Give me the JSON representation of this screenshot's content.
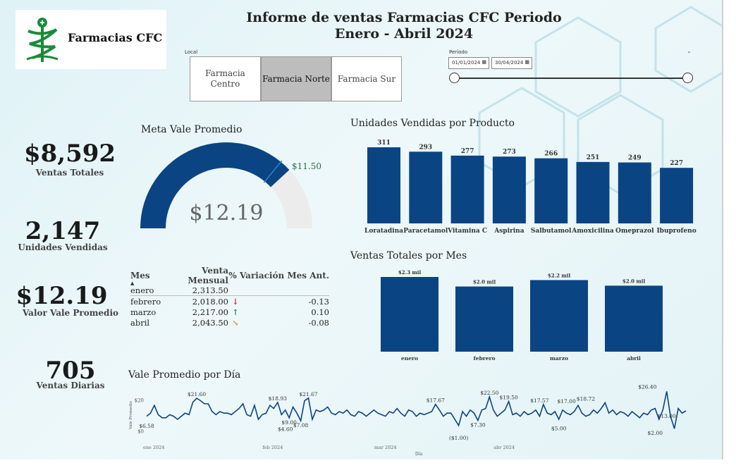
{
  "header": {
    "logo_text": "Farmacias CFC",
    "title_line1": "Informe de ventas Farmacias CFC Periodo",
    "title_line2": "Enero - Abril 2024"
  },
  "slicers": {
    "local_label": "Local",
    "options": [
      {
        "label": "Farmacia Centro",
        "selected": false
      },
      {
        "label": "Farmacia Norte",
        "selected": true
      },
      {
        "label": "Farmacia Sur",
        "selected": false
      }
    ],
    "period_label": "Período",
    "date_start": "01/01/2024",
    "date_end": "30/04/2024"
  },
  "kpis": {
    "ventas_totales": {
      "value": "$8,592",
      "label": "Ventas Totales"
    },
    "unidades_vendidas": {
      "value": "2,147",
      "label": "Unidades Vendidas"
    },
    "valor_vale": {
      "value": "$12.19",
      "label": "Valor Vale Promedio"
    },
    "ventas_diarias": {
      "value": "705",
      "label": "Ventas Diarias"
    }
  },
  "colors": {
    "primary": "#0b4483",
    "gauge_bg": "#ececec",
    "down": "#cc2e2e",
    "up": "#3a8d3a",
    "neutral": "#d29a2a"
  },
  "table": {
    "headers": [
      "Mes",
      "Venta Mensual",
      "% Variación Mes Ant."
    ],
    "rows": [
      {
        "mes": "enero",
        "venta": "2,313.50",
        "icon": "",
        "var": ""
      },
      {
        "mes": "febrero",
        "venta": "2,018.00",
        "icon": "↓",
        "var": "-0.13"
      },
      {
        "mes": "marzo",
        "venta": "2,217.00",
        "icon": "↑",
        "var": "0.10"
      },
      {
        "mes": "abril",
        "venta": "2,043.50",
        "icon": "↘",
        "var": "-0.08"
      }
    ]
  },
  "chart_data": [
    {
      "type": "gauge",
      "title": "Meta Vale Promedio",
      "value": 12.19,
      "value_label": "$12.19",
      "target": 11.5,
      "target_label": "$11.50",
      "min": 0,
      "max": 16
    },
    {
      "type": "bar",
      "title": "Unidades Vendidas por Producto",
      "categories": [
        "Loratadina",
        "Paracetamol",
        "Vitamina C",
        "Aspirina",
        "Salbutamol",
        "Amoxicilina",
        "Omeprazol",
        "Ibuprofeno"
      ],
      "values": [
        311,
        293,
        277,
        273,
        266,
        251,
        249,
        227
      ],
      "data_labels": [
        "311",
        "293",
        "277",
        "273",
        "266",
        "251",
        "249",
        "227"
      ]
    },
    {
      "type": "bar",
      "title": "Ventas Totales por Mes",
      "categories": [
        "enero",
        "febrero",
        "marzo",
        "abril"
      ],
      "values": [
        2313.5,
        2018.0,
        2217.0,
        2043.5
      ],
      "data_labels": [
        "$2.3 mil",
        "$2.0 mil",
        "$2.2 mil",
        "$2.0 mil"
      ]
    },
    {
      "type": "line",
      "title": "Vale Promedio por Día",
      "xlabel": "Día",
      "ylabel": "Vale Promedio",
      "y_ticks": [
        "$0",
        "$20"
      ],
      "ylim": [
        -2,
        28
      ],
      "x_ticks": [
        "ene 2024",
        "feb 2024",
        "mar 2024",
        "abr 2024"
      ],
      "values": [
        10,
        12,
        17,
        11,
        9,
        9,
        11,
        10,
        8,
        10,
        12,
        11,
        19,
        21.6,
        20,
        18,
        18,
        13,
        11,
        13,
        12,
        12,
        11,
        13,
        15,
        18,
        11,
        10,
        17,
        8,
        11,
        12,
        17,
        15,
        18.93,
        11,
        14,
        9,
        16,
        12,
        7.08,
        20,
        21.67,
        8,
        14,
        13,
        14,
        16,
        12,
        11,
        13,
        12,
        14,
        11,
        10,
        13,
        12,
        10,
        12,
        14,
        12,
        11,
        10,
        13,
        12,
        15,
        12,
        10,
        14,
        13,
        10,
        12,
        11,
        12,
        13,
        17.67,
        14,
        10,
        12,
        12,
        8,
        4,
        13,
        10,
        14,
        12,
        7.3,
        14,
        15,
        22.5,
        14,
        10,
        12,
        14,
        19.5,
        11,
        12,
        10,
        13,
        11,
        12,
        14,
        10,
        17.57,
        12,
        11,
        13,
        8,
        14,
        12,
        11,
        13,
        17,
        12,
        10,
        11,
        14,
        12,
        15,
        18.72,
        12,
        14,
        11,
        13,
        12,
        10,
        13,
        11,
        9,
        12,
        11,
        14,
        15,
        8,
        14,
        26,
        10,
        2,
        15,
        12,
        13.5
      ],
      "annotations": [
        {
          "i": 0,
          "v": 6.58,
          "label": "$6.58"
        },
        {
          "i": 13,
          "v": 21.6,
          "label": "$21.60"
        },
        {
          "i": 34,
          "v": 18.93,
          "label": "$18.93"
        },
        {
          "i": 36,
          "v": 4.6,
          "label": "$4.60"
        },
        {
          "i": 37,
          "v": 9.0,
          "label": "$9.00"
        },
        {
          "i": 40,
          "v": 7.08,
          "label": "$7.08"
        },
        {
          "i": 42,
          "v": 21.67,
          "label": "$21.67"
        },
        {
          "i": 75,
          "v": 17.67,
          "label": "$17.67"
        },
        {
          "i": 81,
          "v": -1.0,
          "label": "($1.00)"
        },
        {
          "i": 86,
          "v": 7.3,
          "label": "$7.30"
        },
        {
          "i": 89,
          "v": 22.5,
          "label": "$22.50"
        },
        {
          "i": 94,
          "v": 19.5,
          "label": "$19.50"
        },
        {
          "i": 102,
          "v": 17.57,
          "label": "$17.57"
        },
        {
          "i": 107,
          "v": 5.0,
          "label": "$5.00"
        },
        {
          "i": 109,
          "v": 17.0,
          "label": "$17.00"
        },
        {
          "i": 114,
          "v": 18.72,
          "label": "$18.72"
        },
        {
          "i": 130,
          "v": 26.4,
          "label": "$26.40"
        },
        {
          "i": 132,
          "v": 2.0,
          "label": "$2.00"
        },
        {
          "i": 135,
          "v": 13.0,
          "label": "$13.00"
        }
      ]
    }
  ]
}
